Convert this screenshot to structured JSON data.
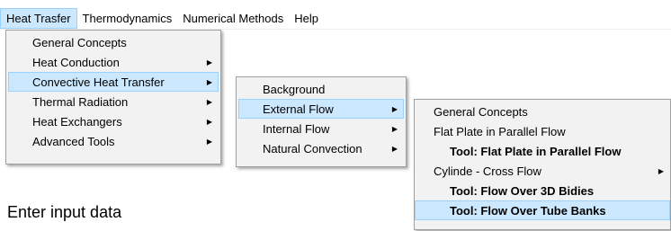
{
  "menubar": {
    "items": [
      {
        "label": "Heat Trasfer"
      },
      {
        "label": "Thermodynamics"
      },
      {
        "label": "Numerical Methods"
      },
      {
        "label": "Help"
      }
    ]
  },
  "heat_transfer_menu": {
    "items": [
      {
        "label": "General Concepts",
        "submenu": false
      },
      {
        "label": "Heat Conduction",
        "submenu": true
      },
      {
        "label": "Convective Heat Transfer",
        "submenu": true
      },
      {
        "label": "Thermal Radiation",
        "submenu": true
      },
      {
        "label": "Heat Exchangers",
        "submenu": true
      },
      {
        "label": "Advanced Tools",
        "submenu": true
      }
    ]
  },
  "convective_menu": {
    "items": [
      {
        "label": "Background",
        "submenu": false
      },
      {
        "label": "External Flow",
        "submenu": true
      },
      {
        "label": "Internal Flow",
        "submenu": true
      },
      {
        "label": "Natural Convection",
        "submenu": true
      }
    ]
  },
  "external_flow_menu": {
    "items": [
      {
        "label": "General Concepts",
        "submenu": false
      },
      {
        "label": "Flat Plate in Parallel Flow",
        "submenu": false
      },
      {
        "label": "Tool: Flat Plate in Parallel Flow",
        "submenu": false
      },
      {
        "label": "Cylinde - Cross Flow",
        "submenu": true
      },
      {
        "label": "Tool: Flow Over 3D Bidies",
        "submenu": false
      },
      {
        "label": "Tool: Flow Over Tube Banks",
        "submenu": false
      }
    ]
  },
  "main": {
    "input_label": "Enter input data"
  },
  "colors": {
    "highlight": "#cce8ff",
    "highlight_border": "#99d1ff",
    "menu_bg": "#f2f2f2"
  }
}
